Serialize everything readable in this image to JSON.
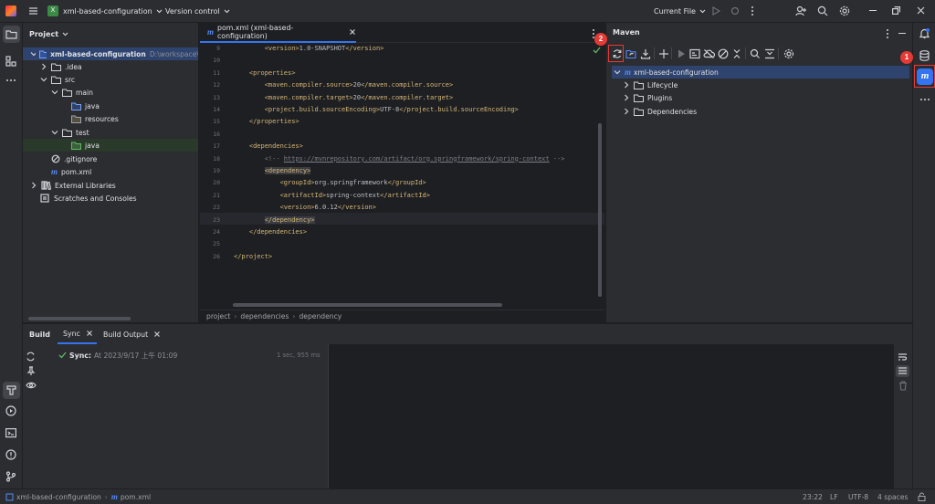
{
  "titlebar": {
    "project_badge": "X",
    "project_name": "xml-based-configuration",
    "vcs": "Version control",
    "run_config": "Current File"
  },
  "project_panel": {
    "title": "Project",
    "root": "xml-based-configuration",
    "root_path": "D:\\workspace\\",
    "idea": ".idea",
    "src": "src",
    "main": "main",
    "java": "java",
    "resources": "resources",
    "test": "test",
    "test_java": "java",
    "gitignore": ".gitignore",
    "pom": "pom.xml",
    "external": "External Libraries",
    "scratches": "Scratches and Consoles"
  },
  "editor": {
    "tab_label": "pom.xml (xml-based-configuration)",
    "lines": [
      {
        "n": "9",
        "t": "        <version>1.0-SNAPSHOT</version>"
      },
      {
        "n": "10",
        "t": ""
      },
      {
        "n": "11",
        "t": "    <properties>"
      },
      {
        "n": "12",
        "t": "        <maven.compiler.source>20</maven.compiler.source>"
      },
      {
        "n": "13",
        "t": "        <maven.compiler.target>20</maven.compiler.target>"
      },
      {
        "n": "14",
        "t": "        <project.build.sourceEncoding>UTF-8</project.build.sourceEncoding>"
      },
      {
        "n": "15",
        "t": "    </properties>"
      },
      {
        "n": "16",
        "t": ""
      },
      {
        "n": "17",
        "t": "    <dependencies>"
      },
      {
        "n": "18",
        "t": "        <!-- https://mvnrepository.com/artifact/org.springframework/spring-context -->"
      },
      {
        "n": "19",
        "t": "        <dependency>"
      },
      {
        "n": "20",
        "t": "            <groupId>org.springframework</groupId>"
      },
      {
        "n": "21",
        "t": "            <artifactId>spring-context</artifactId>"
      },
      {
        "n": "22",
        "t": "            <version>6.0.12</version>"
      },
      {
        "n": "23",
        "t": "        </dependency>"
      },
      {
        "n": "24",
        "t": "    </dependencies>"
      },
      {
        "n": "25",
        "t": ""
      },
      {
        "n": "26",
        "t": "</project>"
      }
    ],
    "breadcrumbs": [
      "project",
      "dependencies",
      "dependency"
    ]
  },
  "maven": {
    "title": "Maven",
    "root": "xml-based-configuration",
    "lifecycle": "Lifecycle",
    "plugins": "Plugins",
    "dependencies": "Dependencies",
    "badge_1": "1",
    "badge_2": "2",
    "maven_icon_letter": "m"
  },
  "build": {
    "tab_build": "Build",
    "tab_sync": "Sync",
    "tab_output": "Build Output",
    "sync_label": "Sync:",
    "sync_time": "At 2023/9/17 上午 01:09",
    "duration": "1 sec, 955 ms"
  },
  "statusbar": {
    "crumb_project": "xml-based-configuration",
    "crumb_file": "pom.xml",
    "position": "23:22",
    "line_sep": "LF",
    "encoding": "UTF-8",
    "indent": "4 spaces"
  },
  "colors": {
    "accent": "#3574f0",
    "highlight_red": "#e53935",
    "selection": "#2e436e"
  }
}
